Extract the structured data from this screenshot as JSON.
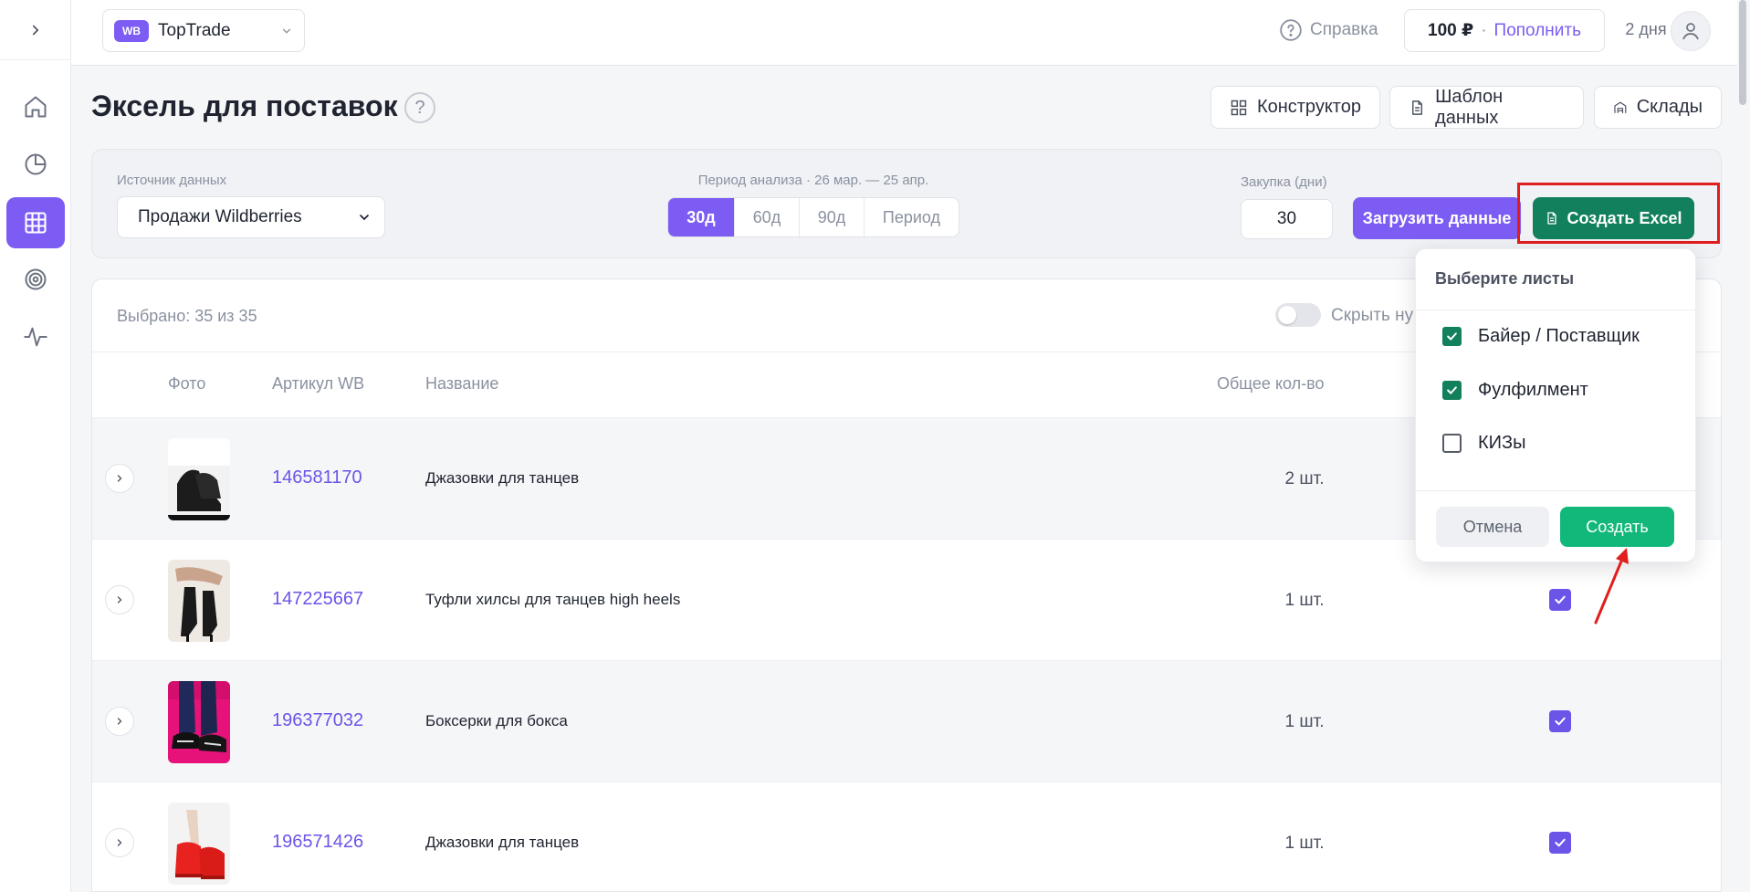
{
  "header": {
    "store_badge": "WB",
    "store_name": "TopTrade",
    "help_label": "Справка",
    "balance_amount": "100 ₽",
    "balance_sep": "·",
    "topup_label": "Пополнить",
    "days_left": "2 дня"
  },
  "page": {
    "title": "Эксель для поставок",
    "help_mark": "?",
    "buttons": {
      "constructor": "Конструктор",
      "template": "Шаблон данных",
      "warehouses": "Склады"
    }
  },
  "filters": {
    "source_label": "Источник данных",
    "source_value": "Продажи Wildberries",
    "period_label": "Период анализа · 26 мар. — 25 апр.",
    "period_options": [
      "30д",
      "60д",
      "90д",
      "Период"
    ],
    "period_selected": "30д",
    "purchase_label": "Закупка (дни)",
    "purchase_value": "30",
    "load_button": "Загрузить данные",
    "excel_button": "Создать Excel"
  },
  "table": {
    "selected_text": "Выбрано: 35 из 35",
    "hide_toggle_label": "Скрыть ну",
    "columns": [
      "Фото",
      "Артикул WB",
      "Название",
      "Общее кол-во"
    ],
    "rows": [
      {
        "sku": "146581170",
        "name": "Джазовки для танцев",
        "qty": "2 шт.",
        "checked": true
      },
      {
        "sku": "147225667",
        "name": "Туфли хилсы для танцев high heels",
        "qty": "1 шт.",
        "checked": true
      },
      {
        "sku": "196377032",
        "name": "Боксерки для бокса",
        "qty": "1 шт.",
        "checked": true
      },
      {
        "sku": "196571426",
        "name": "Джазовки для танцев",
        "qty": "1 шт.",
        "checked": true
      }
    ]
  },
  "popover": {
    "title": "Выберите листы",
    "options": [
      {
        "label": "Байер / Поставщик",
        "checked": true
      },
      {
        "label": "Фулфилмент",
        "checked": true
      },
      {
        "label": "КИЗы",
        "checked": false
      }
    ],
    "cancel": "Отмена",
    "create": "Создать"
  },
  "colors": {
    "accent": "#7c5cf2",
    "excel_green": "#12805c",
    "create_green": "#12b87a",
    "highlight_red": "#e11d1d",
    "link": "#6a55e8"
  },
  "icons": {
    "sidebar": [
      "chevron-right-icon",
      "home-icon",
      "pie-chart-icon",
      "table-grid-icon",
      "target-icon",
      "activity-icon"
    ]
  }
}
